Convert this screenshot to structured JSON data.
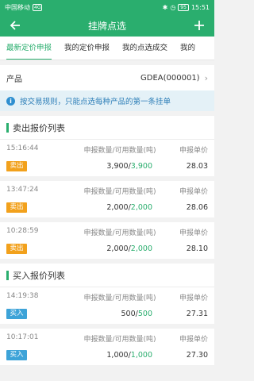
{
  "status_bar": {
    "carrier": "中国移动",
    "network": "4G",
    "battery": "95",
    "time": "15:51"
  },
  "app_bar": {
    "title": "挂牌点选"
  },
  "tabs": [
    {
      "label": "最新定价申报",
      "active": true
    },
    {
      "label": "我的定价申报",
      "active": false
    },
    {
      "label": "我的点选成交",
      "active": false
    },
    {
      "label": "我的",
      "active": false
    }
  ],
  "product": {
    "label": "产品",
    "value": "GDEA(000001)"
  },
  "notice": {
    "text": "按交易规则，只能点选每种产品的第一条挂单"
  },
  "sell_section": {
    "title": "卖出报价列表",
    "rows": [
      {
        "time": "15:16:44",
        "qty_header": "申报数量/可用数量(吨)",
        "price_header": "申报单价",
        "side": "卖出",
        "qty": "3,900",
        "avail": "3,900",
        "price": "28.03"
      },
      {
        "time": "13:47:24",
        "qty_header": "申报数量/可用数量(吨)",
        "price_header": "申报单价",
        "side": "卖出",
        "qty": "2,000",
        "avail": "2,000",
        "price": "28.06"
      },
      {
        "time": "10:28:59",
        "qty_header": "申报数量/可用数量(吨)",
        "price_header": "申报单价",
        "side": "卖出",
        "qty": "2,000",
        "avail": "2,000",
        "price": "28.10"
      }
    ]
  },
  "buy_section": {
    "title": "买入报价列表",
    "rows": [
      {
        "time": "14:19:38",
        "qty_header": "申报数量/可用数量(吨)",
        "price_header": "申报单价",
        "side": "买入",
        "qty": "500",
        "avail": "500",
        "price": "27.31"
      },
      {
        "time": "10:17:01",
        "qty_header": "申报数量/可用数量(吨)",
        "price_header": "申报单价",
        "side": "买入",
        "qty": "1,000",
        "avail": "1,000",
        "price": "27.30"
      }
    ]
  },
  "colors": {
    "primary": "#2aae6e",
    "sell_tag": "#f2a11c",
    "buy_tag": "#3da3d8",
    "notice_bg": "#e4f1f7"
  },
  "icons": {
    "back": "arrow-left-icon",
    "add": "plus-icon",
    "chevron": "chevron-right-icon",
    "info": "info-icon"
  }
}
